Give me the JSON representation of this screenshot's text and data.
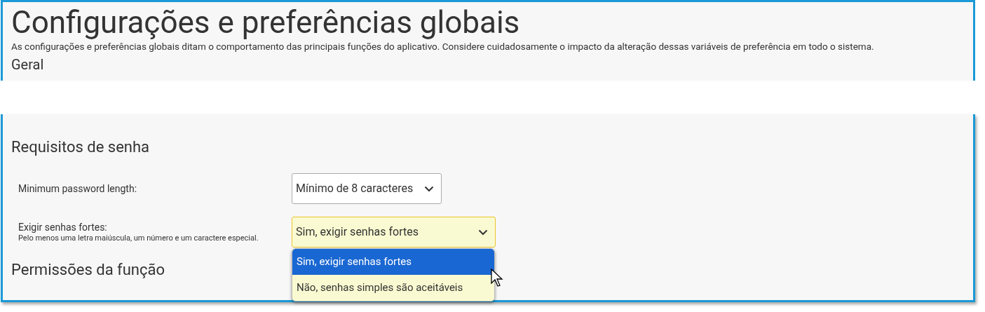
{
  "title": "Configurações e preferências globais",
  "description": "As configurações e preferências globais ditam o comportamento das principais funções do aplicativo. Considere cuidadosamente o impacto da alteração dessas variáveis de preferência em todo o sistema.",
  "general": {
    "heading": "Geral"
  },
  "password": {
    "heading": "Requisitos de senha",
    "fields": [
      {
        "label": "Minimum password length:",
        "select": {
          "value": "Mínimo de 8 caracteres",
          "focused": false
        }
      },
      {
        "label": "Exigir senhas fortes:",
        "hint": "Pelo menos uma letra maiúscula, um número e um caractere especial.",
        "select": {
          "value": "Sim, exigir senhas fortes",
          "focused": true,
          "expanded": true,
          "options": [
            {
              "label": "Sim, exigir senhas fortes",
              "selected": true
            },
            {
              "label": "Não, senhas simples são aceitáveis",
              "selected": false
            }
          ]
        }
      }
    ]
  },
  "permissions": {
    "heading": "Permissões da função"
  }
}
